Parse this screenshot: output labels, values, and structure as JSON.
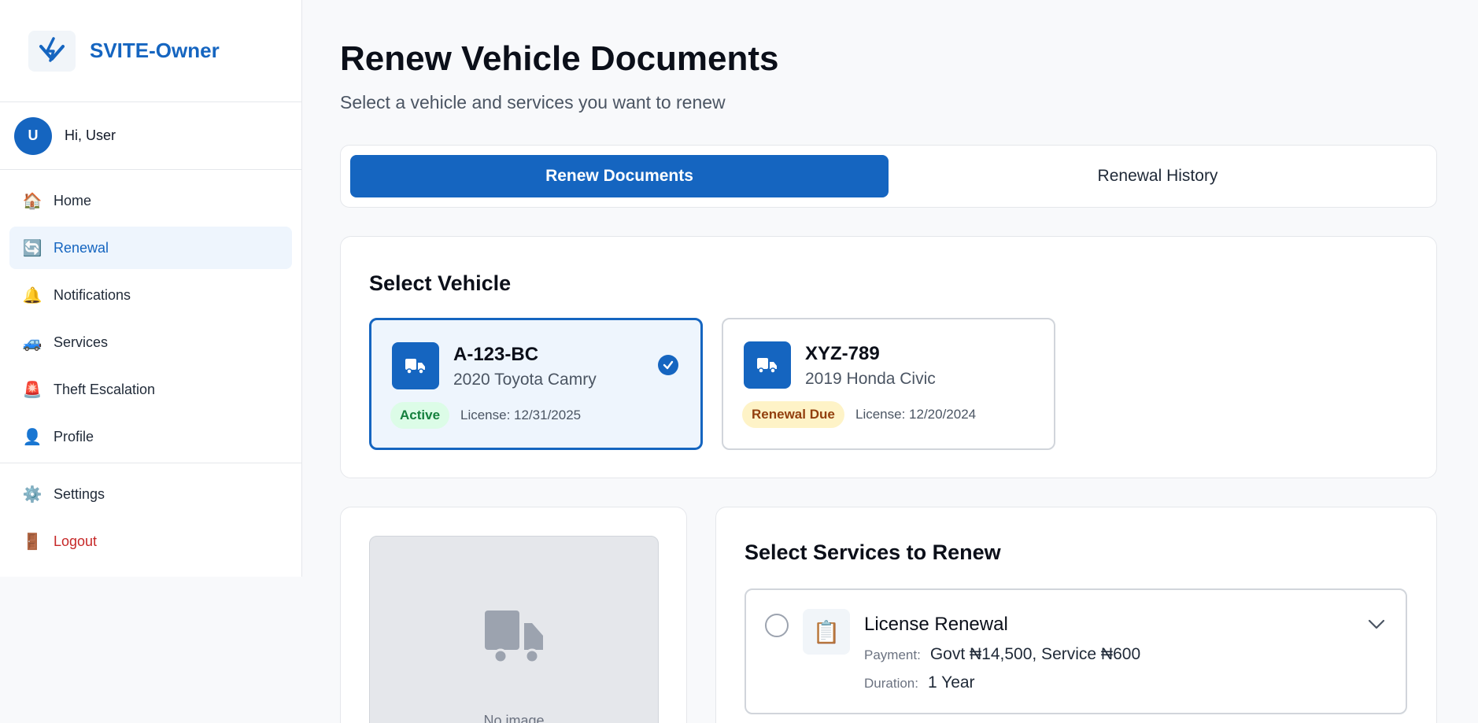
{
  "brand": {
    "name": "SVITE-Owner"
  },
  "user": {
    "initial": "U",
    "greeting": "Hi, User"
  },
  "sidebar": {
    "items": [
      {
        "label": "Home",
        "icon": "🏠",
        "icon_name": "home-icon",
        "active": false
      },
      {
        "label": "Renewal",
        "icon": "🔄",
        "icon_name": "renewal-icon",
        "active": true
      },
      {
        "label": "Notifications",
        "icon": "🔔",
        "icon_name": "bell-icon",
        "active": false
      },
      {
        "label": "Services",
        "icon": "🚙",
        "icon_name": "car-icon",
        "active": false
      },
      {
        "label": "Theft Escalation",
        "icon": "🚨",
        "icon_name": "siren-icon",
        "active": false
      },
      {
        "label": "Profile",
        "icon": "👤",
        "icon_name": "profile-icon",
        "active": false
      }
    ],
    "bottom": [
      {
        "label": "Settings",
        "icon": "⚙️",
        "icon_name": "gear-icon"
      },
      {
        "label": "Logout",
        "icon": "🚪",
        "icon_name": "door-icon"
      }
    ]
  },
  "page": {
    "title": "Renew Vehicle Documents",
    "subtitle": "Select a vehicle and services you want to renew"
  },
  "tabs": [
    {
      "label": "Renew Documents",
      "active": true
    },
    {
      "label": "Renewal History",
      "active": false
    }
  ],
  "vehicle_section": {
    "title": "Select Vehicle",
    "vehicles": [
      {
        "plate": "A-123-BC",
        "model": "2020 Toyota Camry",
        "status": "Active",
        "license": "License: 12/31/2025",
        "selected": true
      },
      {
        "plate": "XYZ-789",
        "model": "2019 Honda Civic",
        "status": "Renewal Due",
        "license": "License: 12/20/2024",
        "selected": false
      }
    ]
  },
  "image_panel": {
    "placeholder_text": "No image"
  },
  "services_section": {
    "title": "Select Services to Renew",
    "services": [
      {
        "name": "License Renewal",
        "icon": "📋",
        "payment_label": "Payment:",
        "payment": "Govt ₦14,500, Service ₦600",
        "duration_label": "Duration:",
        "duration": "1 Year"
      }
    ]
  },
  "colors": {
    "primary": "#1565c0",
    "active_badge": "#dcfce7",
    "due_badge": "#fef3c7",
    "logout": "#c62828"
  }
}
